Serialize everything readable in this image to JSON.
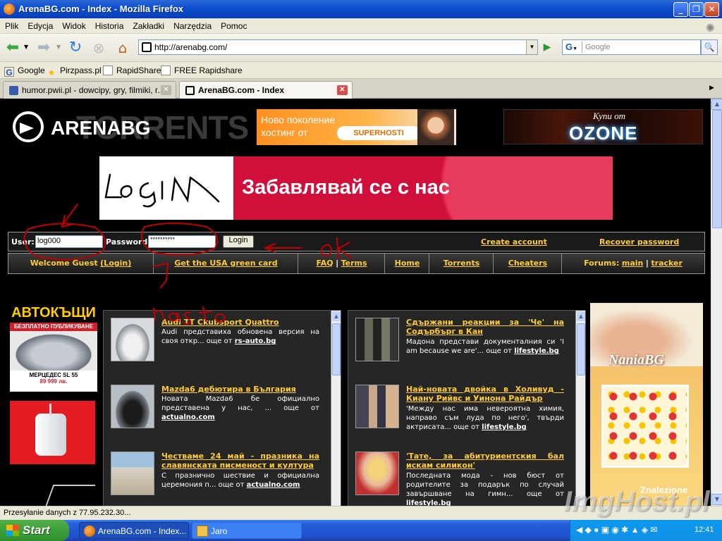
{
  "window": {
    "title": "ArenaBG.com - Index - Mozilla Firefox",
    "controls": [
      "_",
      "❐",
      "✕"
    ]
  },
  "menu": [
    "Plik",
    "Edycja",
    "Widok",
    "Historia",
    "Zakładki",
    "Narzędzia",
    "Pomoc"
  ],
  "nav": {
    "url": "http://arenabg.com/",
    "search_placeholder": "Google"
  },
  "bookmarks": [
    {
      "label": "Google",
      "icon": "google-icon"
    },
    {
      "label": "Pirzpass.pl",
      "icon": "star-icon"
    },
    {
      "label": "RapidShare",
      "icon": "page-icon"
    },
    {
      "label": "FREE Rapidshare",
      "icon": "page-icon"
    }
  ],
  "tabs": [
    {
      "label": "humor.pwii.pl - dowcipy, gry, filmiki, r...",
      "active": false
    },
    {
      "label": "ArenaBG.com - Index",
      "active": true
    }
  ],
  "site": {
    "logo_text": "ARENABG",
    "logo_ghost": "TORRENTS",
    "banner1": {
      "line1": "Ново поколение",
      "line2": "хостинг от",
      "brand": "SUPERHOSTI"
    },
    "banner2": {
      "line1": "Купи от",
      "brand": "OZONE"
    },
    "main_banner": "Забавлявай се с нас",
    "login": {
      "user_label": "User:",
      "user_value": "log000",
      "password_label": "Password",
      "password_value": "**********",
      "button": "Login",
      "create_account": "Create account",
      "recover_password": "Recover password"
    },
    "navrow": {
      "welcome": "Welcome Guest",
      "welcome_login": "(Login)",
      "greencard": "Get the USA green card",
      "faq": "FAQ",
      "sep": "|",
      "terms": "Terms",
      "home": "Home",
      "torrents": "Torrents",
      "cheaters": "Cheaters",
      "forums_label": "Forums:",
      "forums_main": "main",
      "forums_tracker": "tracker"
    },
    "handwriting": {
      "login": "LoGin",
      "ok": "ok",
      "nasto": "nasto"
    },
    "left_ad": {
      "title": "АВТОКЪЩИ",
      "strip": "БЕЗПЛАТНО ПУБЛИКУВАНЕ",
      "car": "МЕРЦЕДЕС SL 55",
      "price": "89 999 лв."
    },
    "news_left": [
      {
        "title": "Audi TT Ckubsport Quattro",
        "desc": "Audi представиха обновена версия на своя откр... още от",
        "src": "rs-auto.bg"
      },
      {
        "title": "Mazda6 дебютира в България",
        "desc": "Новата Mazda6 бе официално представена у нас, ... още от",
        "src": "actualno.com"
      },
      {
        "title": "Честваме 24 май - празника на славянската писменост и култура",
        "desc": "С празнично шествие и официална церемония п... още от",
        "src": "actualno.com"
      }
    ],
    "news_right": [
      {
        "title": "Сдържани реакции за 'Че' на Содърбърг в Кан",
        "desc": "Мадона представи документалния си 'I am because we are'... още от",
        "src": "lifestyle.bg"
      },
      {
        "title": "Най-новата двойка в Холивуд - Киану Рийвс и Уинона Райдър",
        "desc": "'Между нас има невероятна химия, направо съм луда по него', твърди актрисата... още от",
        "src": "lifestyle.bg"
      },
      {
        "title": "'Тате, за абитуриентския бал искам силикон'",
        "desc": "Последната мода - нов бюст от родителите за подарък по случай завършване на гимн... още от",
        "src": "lifestyle.bg"
      }
    ],
    "right_ad": {
      "brand": "NaniaBG"
    },
    "overlay_text": "Znalezione"
  },
  "statusbar": "Przesyłanie danych z 77.95.232.30...",
  "taskbar": {
    "start": "Start",
    "items": [
      {
        "label": "ArenaBG.com - Index...",
        "icon": "firefox-icon"
      },
      {
        "label": "Jaro",
        "icon": "mail-icon"
      }
    ],
    "clock": "12:41"
  },
  "watermark": "ImgHost.pl",
  "colors": {
    "link": "#ffcc33",
    "titlebar": "#0c4fd0",
    "banner_red": "#d0103a"
  }
}
